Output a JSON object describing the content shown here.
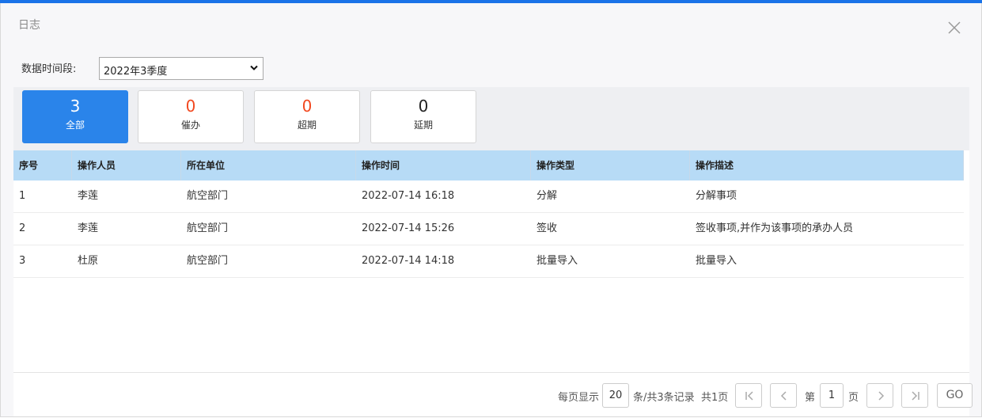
{
  "dialog": {
    "title": "日志"
  },
  "filter": {
    "label": "数据时间段:",
    "selected": "2022年3季度"
  },
  "stats": [
    {
      "count": "3",
      "label": "全部",
      "active": true
    },
    {
      "count": "0",
      "label": "催办",
      "color": "#f2481f"
    },
    {
      "count": "0",
      "label": "超期",
      "color": "#f2481f"
    },
    {
      "count": "0",
      "label": "延期",
      "color": "#222222"
    }
  ],
  "table": {
    "columns": [
      "序号",
      "操作人员",
      "所在单位",
      "操作时间",
      "操作类型",
      "操作描述"
    ],
    "rows": [
      [
        "1",
        "李莲",
        "航空部门",
        "2022-07-14 16:18",
        "分解",
        "分解事项"
      ],
      [
        "2",
        "李莲",
        "航空部门",
        "2022-07-14 15:26",
        "签收",
        "签收事项,并作为该事项的承办人员"
      ],
      [
        "3",
        "杜原",
        "航空部门",
        "2022-07-14 14:18",
        "批量导入",
        "批量导入"
      ]
    ]
  },
  "pagination": {
    "per_page_label": "每页显示",
    "per_page": "20",
    "records_text": "条/共3条记录",
    "total_pages_text": "共1页",
    "page_prefix": "第",
    "current_page": "1",
    "page_suffix": "页",
    "go_label": "GO"
  },
  "colors": {
    "accent": "#2a84ea",
    "header_bg": "#b7dbf6",
    "alert": "#f2481f"
  }
}
